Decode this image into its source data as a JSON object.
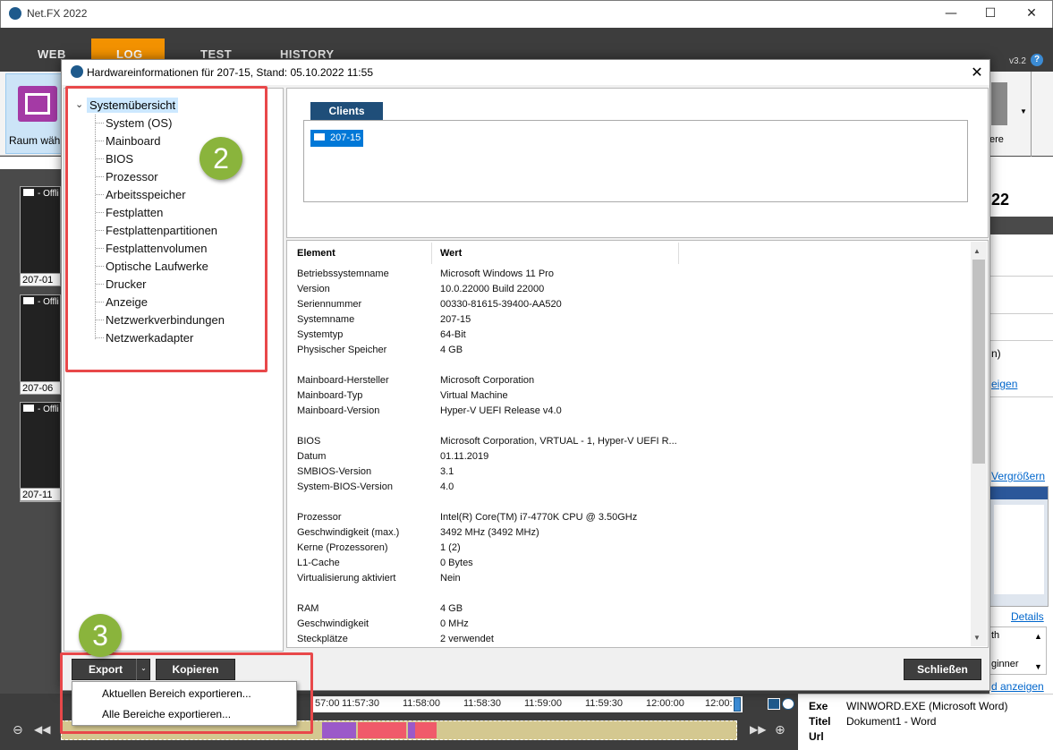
{
  "app": {
    "title": "Net.FX 2022",
    "version": "v3.2",
    "nav_tabs": [
      "WEB",
      "LOG",
      "TEST",
      "HISTORY"
    ],
    "raum_label": "Raum wähl",
    "right_fragments": [
      "ere",
      "22",
      "n)",
      "eigen",
      "Vergrößern",
      "Details",
      "th",
      "ginner",
      "d anzeigen"
    ]
  },
  "clients_left": [
    {
      "head": "- Offli",
      "foot": "207-01"
    },
    {
      "head": "- Offli",
      "foot": "207-06"
    },
    {
      "head": "- Offli",
      "foot": "207-11"
    }
  ],
  "dialog": {
    "title": "Hardwareinformationen für 207-15, Stand: 05.10.2022 11:55",
    "tree_root": "Systemübersicht",
    "tree_items": [
      "System (OS)",
      "Mainboard",
      "BIOS",
      "Prozessor",
      "Arbeitsspeicher",
      "Festplatten",
      "Festplattenpartitionen",
      "Festplattenvolumen",
      "Optische Laufwerke",
      "Drucker",
      "Anzeige",
      "Netzwerkverbindungen",
      "Netzwerkadapter"
    ],
    "clients_tab": "Clients",
    "client_chip": "207-15",
    "col_element": "Element",
    "col_value": "Wert",
    "rows": [
      [
        "Betriebssystemname",
        "Microsoft Windows 11 Pro"
      ],
      [
        "Version",
        "10.0.22000 Build 22000"
      ],
      [
        "Seriennummer",
        "00330-81615-39400-AA520"
      ],
      [
        "Systemname",
        "207-15"
      ],
      [
        "Systemtyp",
        "64-Bit"
      ],
      [
        "Physischer Speicher",
        "4 GB"
      ],
      [
        "Mainboard-Hersteller",
        "Microsoft Corporation"
      ],
      [
        "Mainboard-Typ",
        "Virtual Machine"
      ],
      [
        "Mainboard-Version",
        "Hyper-V UEFI Release v4.0"
      ],
      [
        "BIOS",
        "Microsoft Corporation, VRTUAL - 1, Hyper-V UEFI R..."
      ],
      [
        "Datum",
        "01.11.2019"
      ],
      [
        "SMBIOS-Version",
        "3.1"
      ],
      [
        "System-BIOS-Version",
        "4.0"
      ],
      [
        "Prozessor",
        "Intel(R) Core(TM) i7-4770K CPU @ 3.50GHz"
      ],
      [
        "Geschwindigkeit (max.)",
        "3492 MHz (3492 MHz)"
      ],
      [
        "Kerne (Prozessoren)",
        "1 (2)"
      ],
      [
        "L1-Cache",
        "0 Bytes"
      ],
      [
        "Virtualisierung aktiviert",
        "Nein"
      ],
      [
        "RAM",
        "4 GB"
      ],
      [
        "Geschwindigkeit",
        "0 MHz"
      ],
      [
        "Steckplätze",
        "2 verwendet"
      ]
    ],
    "export_label": "Export",
    "copy_label": "Kopieren",
    "close_label": "Schließen",
    "export_menu": [
      "Aktuellen Bereich exportieren...",
      "Alle Bereiche exportieren..."
    ]
  },
  "annotations": {
    "badge_tree": "2",
    "badge_export": "3"
  },
  "timeline": {
    "times": [
      "57:00",
      "11:57:30",
      "11:58:00",
      "11:58:30",
      "11:59:00",
      "11:59:30",
      "12:00:00",
      "12:00:"
    ]
  },
  "info": {
    "exe_key": "Exe",
    "exe_val": "WINWORD.EXE (Microsoft Word)",
    "title_key": "Titel",
    "title_val": "Dokument1 - Word",
    "url_key": "Url"
  }
}
